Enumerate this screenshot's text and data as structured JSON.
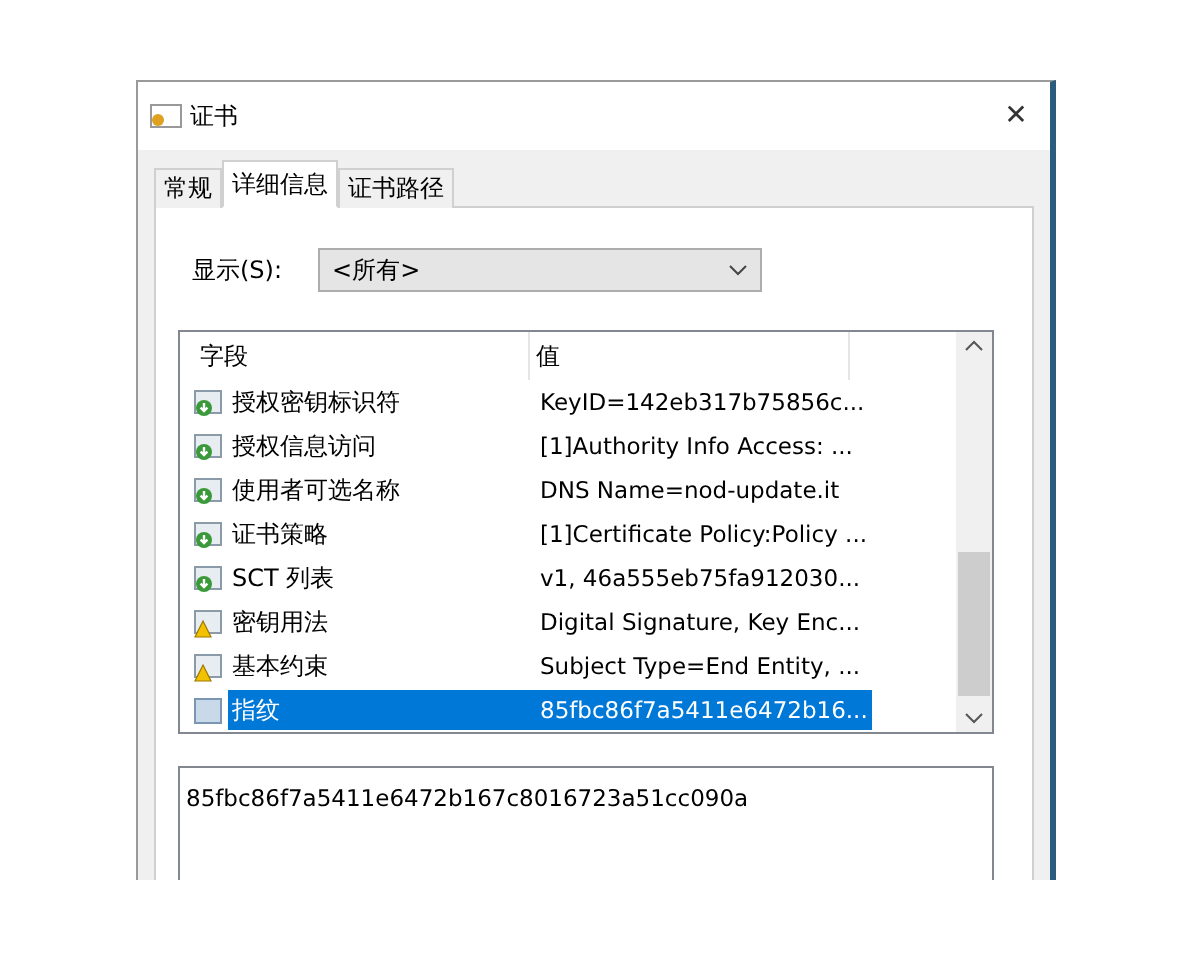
{
  "window": {
    "title": "证书",
    "close": "✕"
  },
  "tabs": [
    {
      "label": "常规",
      "selected": false
    },
    {
      "label": "详细信息",
      "selected": true
    },
    {
      "label": "证书路径",
      "selected": false
    }
  ],
  "show": {
    "label": "显示(S):",
    "value": "<所有>"
  },
  "table": {
    "columns": [
      "字段",
      "值"
    ],
    "rows": [
      {
        "kind": "extension",
        "field": "授权密钥标识符",
        "value": "KeyID=142eb317b75856c...",
        "selected": false
      },
      {
        "kind": "extension",
        "field": "授权信息访问",
        "value": "[1]Authority Info Access: ...",
        "selected": false
      },
      {
        "kind": "extension",
        "field": "使用者可选名称",
        "value": "DNS Name=nod-update.it",
        "selected": false
      },
      {
        "kind": "extension",
        "field": "证书策略",
        "value": "[1]Certificate Policy:Policy ...",
        "selected": false
      },
      {
        "kind": "extension",
        "field": "SCT 列表",
        "value": "v1, 46a555eb75fa912030...",
        "selected": false
      },
      {
        "kind": "critical",
        "field": "密钥用法",
        "value": "Digital Signature, Key Enc...",
        "selected": false
      },
      {
        "kind": "critical",
        "field": "基本约束",
        "value": "Subject Type=End Entity, ...",
        "selected": false
      },
      {
        "kind": "property",
        "field": "指纹",
        "value": "85fbc86f7a5411e6472b16...",
        "selected": true
      }
    ]
  },
  "detail": {
    "value": "85fbc86f7a5411e6472b167c8016723a51cc090a"
  }
}
